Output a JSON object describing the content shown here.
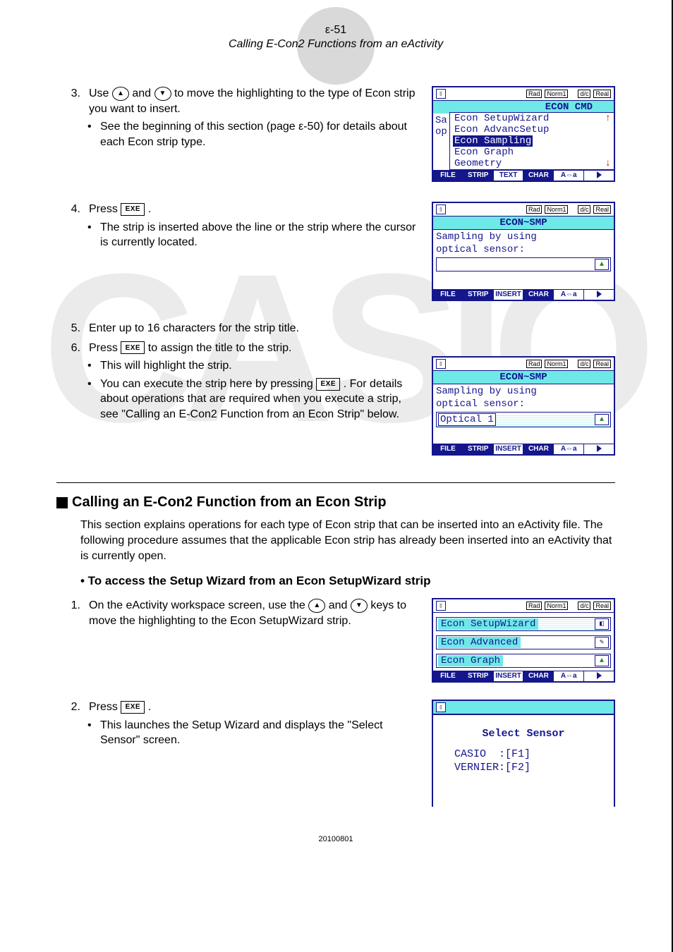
{
  "page": {
    "number_label": "ε-51",
    "chapter_title": "Calling E-Con2 Functions from an eActivity",
    "footer_code": "20100801"
  },
  "steps": {
    "s3": {
      "num": "3.",
      "text_parts": [
        "Use ",
        " and ",
        " to move the highlighting to the type of Econ strip you want to insert."
      ],
      "bullet": "See the beginning of this section (page ε-50) for details about each Econ strip type."
    },
    "s4": {
      "num": "4.",
      "text": "Press ",
      "after": ".",
      "bullet": "The strip is inserted above the line or the strip where the cursor is currently located."
    },
    "s5": {
      "num": "5.",
      "text": "Enter up to 16 characters for the strip title."
    },
    "s6": {
      "num": "6.",
      "text_a": "Press ",
      "text_b": " to assign the title to the strip.",
      "bullet1": "This will highlight the strip.",
      "bullet2_a": "You can execute the strip here by pressing ",
      "bullet2_b": ". For details about operations that are required when you execute a strip, see \"Calling an E-Con2 Function from an Econ Strip\" below."
    }
  },
  "section2": {
    "heading": "Calling an E-Con2 Function from an Econ Strip",
    "intro": "This section explains operations for each type of Econ strip that can be inserted into an eActivity file. The following procedure assumes that the applicable Econ strip has already been inserted into an eActivity that is currently open.",
    "sub_heading": "• To access the Setup Wizard from an Econ SetupWizard strip",
    "s1": {
      "num": "1.",
      "text_a": "On the eActivity workspace screen, use the ",
      "text_b": " and ",
      "text_c": " keys to move the highlighting to the Econ SetupWizard strip."
    },
    "s2": {
      "num": "2.",
      "text": "Press ",
      "after": ".",
      "bullet": "This launches the Setup Wizard and displays the \"Select Sensor\" screen."
    }
  },
  "keys": {
    "up": "▲",
    "down": "▼",
    "exe": "EXE"
  },
  "screens": {
    "status_tags": [
      "Rad",
      "Norm1",
      "d/c",
      "Real"
    ],
    "menu_popup": {
      "above_title": "ECON   CMD",
      "left_frag_line1": "Sa",
      "left_frag_line2": "op",
      "items": [
        "Econ SetupWizard",
        "Econ AdvancSetup",
        "Econ Sampling",
        "Econ Graph",
        "Geometry"
      ],
      "selected_index": 2,
      "up_arrow": "↑",
      "down_arrow": "↓"
    },
    "fkeys_a": [
      "FILE",
      "STRIP",
      "TEXT",
      "CHAR",
      "A⇔a"
    ],
    "fkeys_b": [
      "FILE",
      "STRIP",
      "INSERT",
      "CHAR",
      "A⇔a"
    ],
    "smp_title": "ECON~SMP",
    "smp_lines": [
      "Sampling by using",
      "optical sensor:"
    ],
    "optical_strip_label": "Optical 1",
    "econ_strips": [
      "Econ SetupWizard",
      "Econ Advanced",
      "Econ Graph"
    ],
    "dialog": {
      "title": "Select Sensor",
      "opt1": "CASIO  :[F1]",
      "opt2": "VERNIER:[F2]"
    }
  }
}
